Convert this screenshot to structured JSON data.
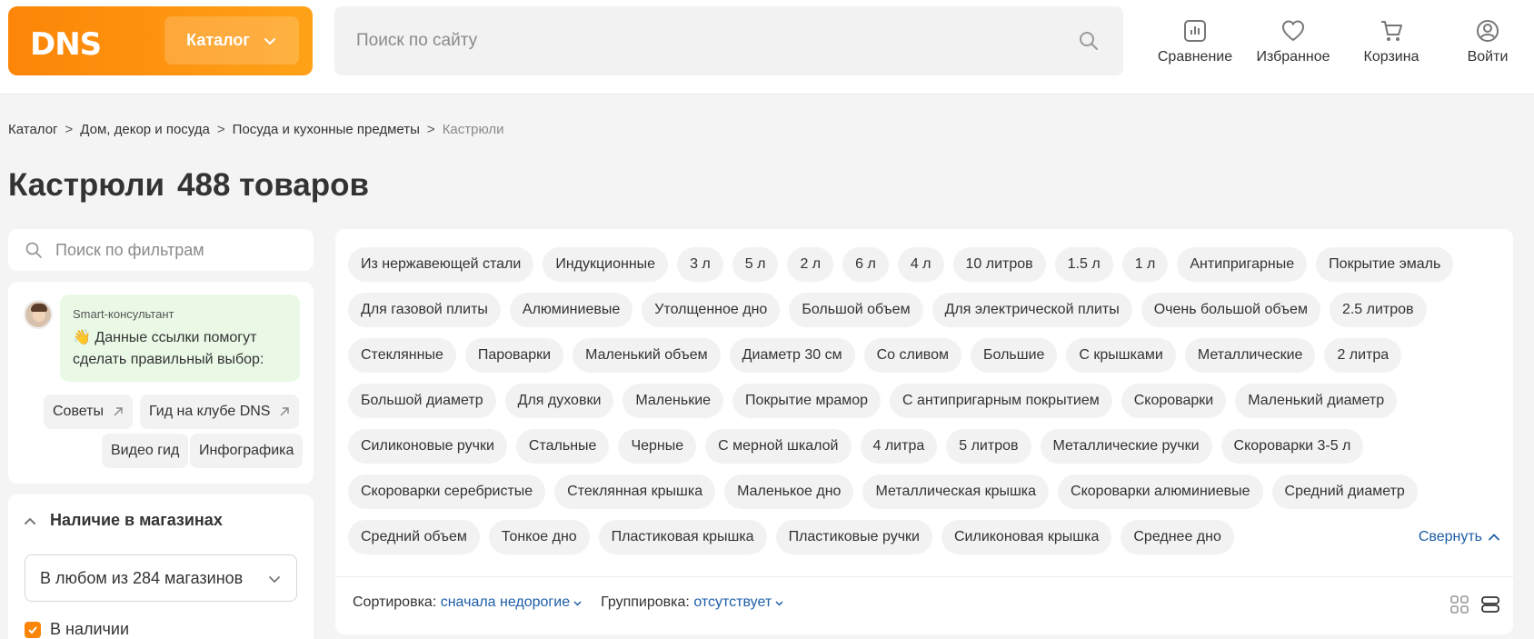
{
  "header": {
    "logo": "DNS",
    "catalog_label": "Каталог",
    "search_placeholder": "Поиск по сайту",
    "nav": [
      {
        "label": "Сравнение",
        "icon": "compare-icon"
      },
      {
        "label": "Избранное",
        "icon": "heart-icon"
      },
      {
        "label": "Корзина",
        "icon": "cart-icon"
      },
      {
        "label": "Войти",
        "icon": "user-icon"
      }
    ]
  },
  "breadcrumb": [
    "Каталог",
    "Дом, декор и посуда",
    "Посуда и кухонные предметы",
    "Кастрюли"
  ],
  "page": {
    "title": "Кастрюли",
    "count": "488 товаров"
  },
  "filters": {
    "search_placeholder": "Поиск по фильтрам",
    "consultant": {
      "name": "Smart-консультант",
      "message": "👋 Данные ссылки помогут сделать правильный выбор:",
      "links": [
        "Советы",
        "Гид на клубе DNS",
        "Видео гид",
        "Инфографика"
      ]
    },
    "availability": {
      "title": "Наличие в магазинах",
      "select_value": "В любом из 284 магазинов",
      "checkbox_label": "В наличии"
    }
  },
  "tags": [
    "Из нержавеющей стали",
    "Индукционные",
    "3 л",
    "5 л",
    "2 л",
    "6 л",
    "4 л",
    "10 литров",
    "1.5 л",
    "1 л",
    "Антипригарные",
    "Покрытие эмаль",
    "Для газовой плиты",
    "Алюминиевые",
    "Утолщенное дно",
    "Большой объем",
    "Для электрической плиты",
    "Очень большой объем",
    "2.5 литров",
    "Стеклянные",
    "Пароварки",
    "Маленький объем",
    "Диаметр 30 см",
    "Со сливом",
    "Большие",
    "С крышками",
    "Металлические",
    "2 литра",
    "Большой диаметр",
    "Для духовки",
    "Маленькие",
    "Покрытие мрамор",
    "С антипригарным покрытием",
    "Скороварки",
    "Маленький диаметр",
    "Силиконовые ручки",
    "Стальные",
    "Черные",
    "С мерной шкалой",
    "4 литра",
    "5 литров",
    "Металлические ручки",
    "Скороварки 3-5 л",
    "Скороварки серебристые",
    "Стеклянная крышка",
    "Маленькое дно",
    "Металлическая крышка",
    "Скороварки алюминиевые",
    "Средний диаметр",
    "Средний объем",
    "Тонкое дно",
    "Пластиковая крышка",
    "Пластиковые ручки",
    "Силиконовая крышка",
    "Среднее дно"
  ],
  "collapse_label": "Свернуть",
  "sorting": {
    "sort_label": "Сортировка:",
    "sort_value": "сначала недорогие",
    "group_label": "Группировка:",
    "group_value": "отсутствует"
  },
  "colors": {
    "brand": "#fc8507",
    "link": "#1c5ea8"
  }
}
